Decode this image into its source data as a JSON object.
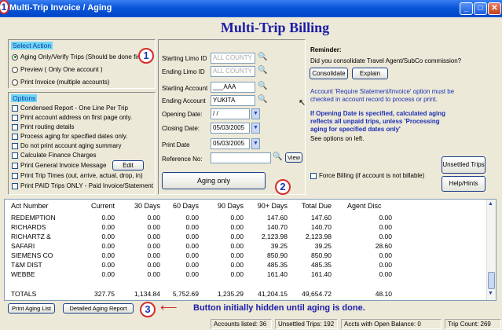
{
  "window": {
    "title": "Multi-Trip Invoice / Aging",
    "callout_title": "1"
  },
  "heading": "Multi-Trip Billing",
  "select_action": {
    "label": "Select Action",
    "options": [
      "Aging Only/Verify Trips (Should be done first)",
      "Preview  ( Only One account )",
      "Print Invoice  (multiple accounts)"
    ],
    "selected": 0
  },
  "options": {
    "label": "Options",
    "items": [
      "Condensed Report - One Line Per Trip",
      "Print account address on first page only.",
      "Print routing details",
      "Process aging for specified dates only.",
      "Do not print account aging summary",
      "Calculate Finance Charges",
      "Print General Invoice Message",
      "Print Trip Times (out, arrive, actual, drop, in)",
      "Print PAID Trips ONLY - Paid Invoice/Statement"
    ],
    "edit_label": "Edit"
  },
  "form": {
    "starting_limo_label": "Starting Limo ID",
    "starting_limo_value": "ALL COUNTY",
    "ending_limo_label": "Ending Limo ID",
    "ending_limo_value": "ALL COUNTY",
    "starting_account_label": "Starting Account",
    "starting_account_value": "___AAA",
    "ending_account_label": "Ending Account",
    "ending_account_value": "YUKITA",
    "opening_date_label": "Opening Date:",
    "opening_date_value": " / /",
    "closing_date_label": "Closing Date:",
    "closing_date_value": "05/03/2005",
    "print_date_label": "Print Date",
    "print_date_value": "05/03/2005",
    "reference_label": "Reference No:",
    "reference_value": "",
    "view_label": "View",
    "aging_button": "Aging only",
    "force_billing": "Force Billing (if account is not billable)"
  },
  "reminder": {
    "title": "Reminder:",
    "question": "Did you consolidate Travel Agent/SubCo commission?",
    "consolidate": "Consolidate",
    "explain": "Explain",
    "note": "Account 'Require Statement/Invoice' option must be checked in account record to process or print.",
    "bold_note": "If Opening Date is specified, calculated aging reflects all unpaid trips,  unless 'Processing aging for specified dates only'",
    "see": "See options on left.",
    "unsettled": "Unsettled Trips",
    "help": "Help/Hints"
  },
  "callouts": {
    "c1": "1",
    "c2": "2",
    "c3": "3"
  },
  "table": {
    "headers": [
      "Act Number",
      "Current",
      "30 Days",
      "60 Days",
      "90 Days",
      "90+ Days",
      "Total Due",
      "Agent Disc"
    ],
    "rows": [
      [
        "REDEMPTION",
        "0.00",
        "0.00",
        "0.00",
        "0.00",
        "147.60",
        "147.60",
        "0.00"
      ],
      [
        "RICHARDS",
        "0.00",
        "0.00",
        "0.00",
        "0.00",
        "140.70",
        "140.70",
        "0.00"
      ],
      [
        "RICHARTZ &",
        "0.00",
        "0.00",
        "0.00",
        "0.00",
        "2,123.98",
        "2,123.98",
        "0.00"
      ],
      [
        "SAFARI",
        "0.00",
        "0.00",
        "0.00",
        "0.00",
        "39.25",
        "39.25",
        "28.60"
      ],
      [
        "SIEMENS CO",
        "0.00",
        "0.00",
        "0.00",
        "0.00",
        "850.90",
        "850.90",
        "0.00"
      ],
      [
        "T&M DIST",
        "0.00",
        "0.00",
        "0.00",
        "0.00",
        "485.35",
        "485.35",
        "0.00"
      ],
      [
        "WEBBE",
        "0.00",
        "0.00",
        "0.00",
        "0.00",
        "161.40",
        "161.40",
        "0.00"
      ]
    ],
    "totals": [
      "TOTALS",
      "327.75",
      "1,134.84",
      "5,752.69",
      "1,235.29",
      "41,204.15",
      "49,654.72",
      "48.10"
    ]
  },
  "bottom": {
    "print_aging": "Print Aging List",
    "detailed_aging": "Detailed Aging Report",
    "annotation": "Button initially hidden until aging is done."
  },
  "statusbar": {
    "accounts_listed": "Accounts listed: 36",
    "unsettled_trips": "Unsettled Trips: 192",
    "open_balance": "Accts with Open Balance: 0",
    "trip_count": "Trip Count: 269"
  }
}
